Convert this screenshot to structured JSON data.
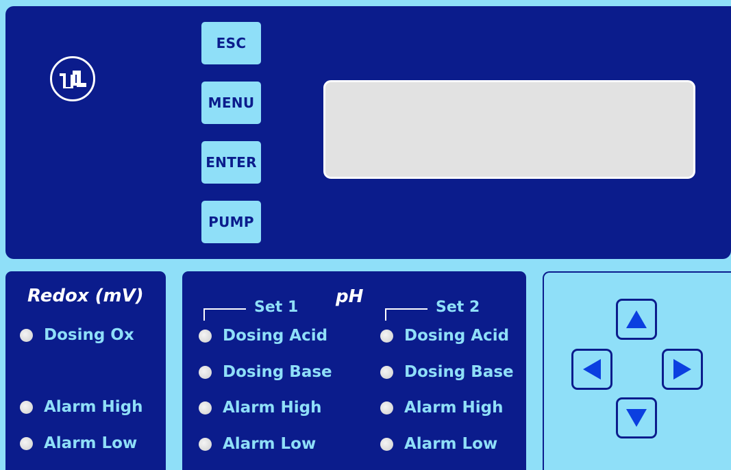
{
  "keypad": {
    "esc_label": "ESC",
    "menu_label": "MENU",
    "enter_label": "ENTER",
    "pump_label": "PUMP"
  },
  "display": {
    "text": ""
  },
  "redox": {
    "title": "Redox (mV)",
    "indicators": [
      "Dosing Ox",
      "Alarm High",
      "Alarm Low"
    ]
  },
  "ph": {
    "title": "pH",
    "set1": {
      "label": "Set 1",
      "indicators": [
        "Dosing Acid",
        "Dosing Base",
        "Alarm High",
        "Alarm Low"
      ]
    },
    "set2": {
      "label": "Set 2",
      "indicators": [
        "Dosing Acid",
        "Dosing Base",
        "Alarm High",
        "Alarm Low"
      ]
    }
  },
  "navigation": {
    "icons": [
      "arrow-up-icon",
      "arrow-left-icon",
      "arrow-right-icon",
      "arrow-down-icon"
    ]
  },
  "colors": {
    "panel": "#0b1c8c",
    "background": "#8fdff8",
    "display": "#e2e2e2",
    "led_off": "#d9d9d9",
    "arrow": "#0b3fe0"
  }
}
